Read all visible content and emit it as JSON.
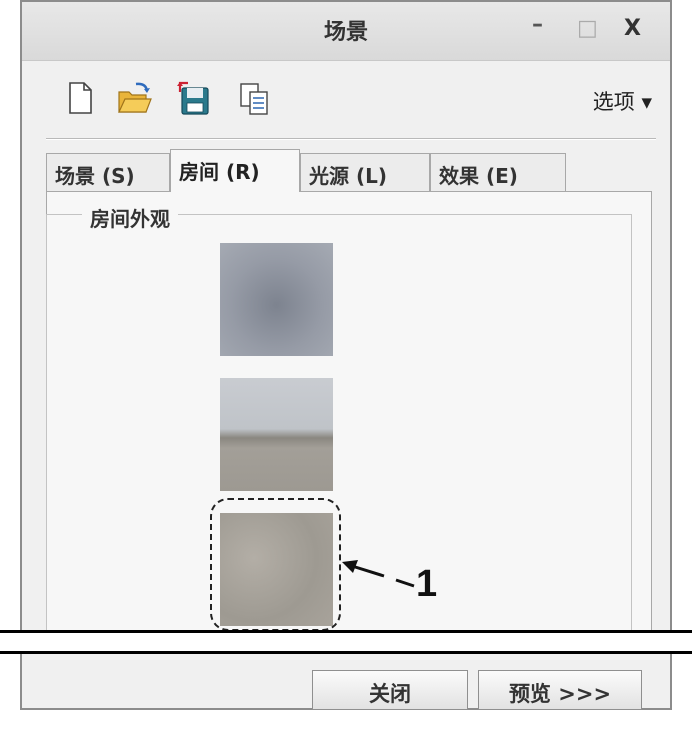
{
  "window": {
    "title": "场景",
    "controls": {
      "minimize": "–",
      "maximize": "□",
      "close": "X"
    }
  },
  "toolbar": {
    "icons": [
      "new-file-icon",
      "open-folder-icon",
      "save-icon",
      "copy-icon"
    ],
    "options_label": "选项 ▾"
  },
  "tabs": [
    {
      "label": "场景 (S)",
      "active": false
    },
    {
      "label": "房间 (R)",
      "active": true
    },
    {
      "label": "光源 (L)",
      "active": false
    },
    {
      "label": "效果 (E)",
      "active": false
    }
  ],
  "room_panel": {
    "group_label": "房间外观",
    "thumbnails": [
      "gray-sky-texture",
      "desert-road-texture",
      "sand-ground-texture"
    ],
    "selected_index": 2
  },
  "annotation": {
    "callout": "1"
  },
  "footer": {
    "close_label": "关闭",
    "preview_label": "预览 >>>"
  }
}
